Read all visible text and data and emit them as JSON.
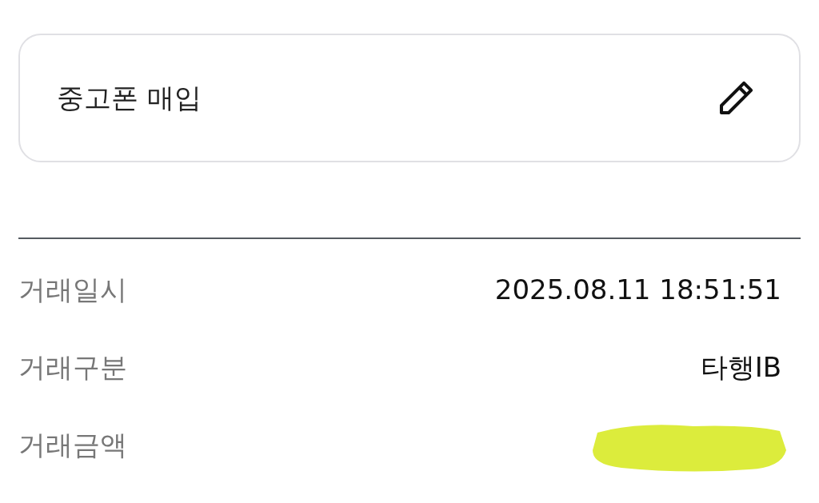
{
  "memo_card": {
    "text": "중고폰 매입"
  },
  "details": [
    {
      "kind": "text",
      "label": "거래일시",
      "value": "2025.08.11 18:51:51"
    },
    {
      "kind": "text",
      "label": "거래구분",
      "value": "타행IB"
    },
    {
      "kind": "redacted",
      "label": "거래금액"
    }
  ]
}
